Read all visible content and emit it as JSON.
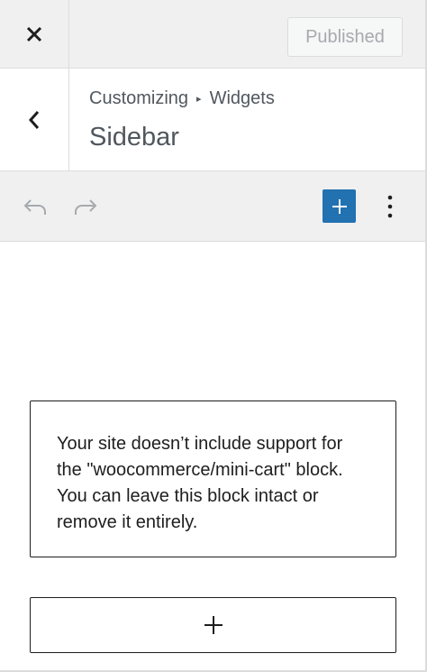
{
  "header": {
    "close_icon": "close-icon",
    "publish_label": "Published"
  },
  "section": {
    "back_icon": "chevron-left-icon",
    "breadcrumb": {
      "parent": "Customizing",
      "separator": "▸",
      "child": "Widgets"
    },
    "title": "Sidebar"
  },
  "toolbar": {
    "undo_icon": "undo-icon",
    "redo_icon": "redo-icon",
    "add_block_icon": "plus-icon",
    "options_icon": "more-vertical-icon"
  },
  "content": {
    "notice_text": "Your site doesn’t include support for the \"woocommerce/mini-cart\" block. You can leave this block intact or remove it entirely.",
    "appender_icon": "plus-icon"
  },
  "colors": {
    "accent": "#2271b1",
    "chrome_bg": "#f0f0f1",
    "border": "#dcdcde",
    "muted_text": "#50575e",
    "disabled_text": "#a7aaad"
  }
}
